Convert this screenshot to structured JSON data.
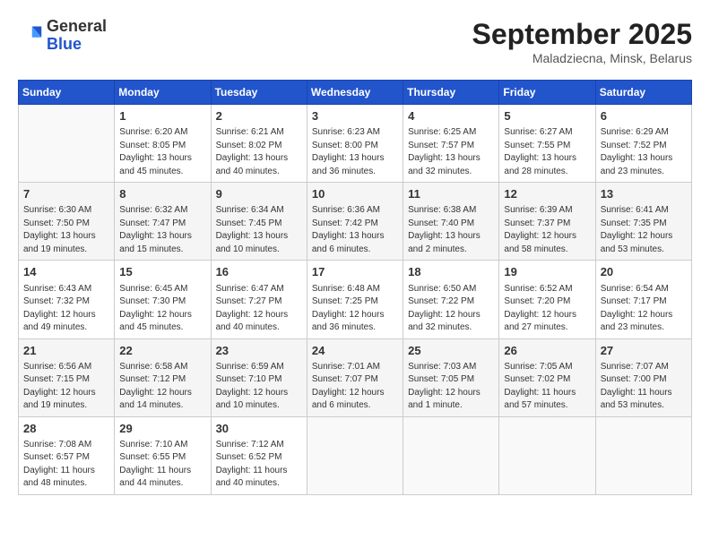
{
  "header": {
    "logo_general": "General",
    "logo_blue": "Blue",
    "month_title": "September 2025",
    "location": "Maladziecna, Minsk, Belarus"
  },
  "weekdays": [
    "Sunday",
    "Monday",
    "Tuesday",
    "Wednesday",
    "Thursday",
    "Friday",
    "Saturday"
  ],
  "weeks": [
    [
      {
        "day": "",
        "content": ""
      },
      {
        "day": "1",
        "content": "Sunrise: 6:20 AM\nSunset: 8:05 PM\nDaylight: 13 hours\nand 45 minutes."
      },
      {
        "day": "2",
        "content": "Sunrise: 6:21 AM\nSunset: 8:02 PM\nDaylight: 13 hours\nand 40 minutes."
      },
      {
        "day": "3",
        "content": "Sunrise: 6:23 AM\nSunset: 8:00 PM\nDaylight: 13 hours\nand 36 minutes."
      },
      {
        "day": "4",
        "content": "Sunrise: 6:25 AM\nSunset: 7:57 PM\nDaylight: 13 hours\nand 32 minutes."
      },
      {
        "day": "5",
        "content": "Sunrise: 6:27 AM\nSunset: 7:55 PM\nDaylight: 13 hours\nand 28 minutes."
      },
      {
        "day": "6",
        "content": "Sunrise: 6:29 AM\nSunset: 7:52 PM\nDaylight: 13 hours\nand 23 minutes."
      }
    ],
    [
      {
        "day": "7",
        "content": "Sunrise: 6:30 AM\nSunset: 7:50 PM\nDaylight: 13 hours\nand 19 minutes."
      },
      {
        "day": "8",
        "content": "Sunrise: 6:32 AM\nSunset: 7:47 PM\nDaylight: 13 hours\nand 15 minutes."
      },
      {
        "day": "9",
        "content": "Sunrise: 6:34 AM\nSunset: 7:45 PM\nDaylight: 13 hours\nand 10 minutes."
      },
      {
        "day": "10",
        "content": "Sunrise: 6:36 AM\nSunset: 7:42 PM\nDaylight: 13 hours\nand 6 minutes."
      },
      {
        "day": "11",
        "content": "Sunrise: 6:38 AM\nSunset: 7:40 PM\nDaylight: 13 hours\nand 2 minutes."
      },
      {
        "day": "12",
        "content": "Sunrise: 6:39 AM\nSunset: 7:37 PM\nDaylight: 12 hours\nand 58 minutes."
      },
      {
        "day": "13",
        "content": "Sunrise: 6:41 AM\nSunset: 7:35 PM\nDaylight: 12 hours\nand 53 minutes."
      }
    ],
    [
      {
        "day": "14",
        "content": "Sunrise: 6:43 AM\nSunset: 7:32 PM\nDaylight: 12 hours\nand 49 minutes."
      },
      {
        "day": "15",
        "content": "Sunrise: 6:45 AM\nSunset: 7:30 PM\nDaylight: 12 hours\nand 45 minutes."
      },
      {
        "day": "16",
        "content": "Sunrise: 6:47 AM\nSunset: 7:27 PM\nDaylight: 12 hours\nand 40 minutes."
      },
      {
        "day": "17",
        "content": "Sunrise: 6:48 AM\nSunset: 7:25 PM\nDaylight: 12 hours\nand 36 minutes."
      },
      {
        "day": "18",
        "content": "Sunrise: 6:50 AM\nSunset: 7:22 PM\nDaylight: 12 hours\nand 32 minutes."
      },
      {
        "day": "19",
        "content": "Sunrise: 6:52 AM\nSunset: 7:20 PM\nDaylight: 12 hours\nand 27 minutes."
      },
      {
        "day": "20",
        "content": "Sunrise: 6:54 AM\nSunset: 7:17 PM\nDaylight: 12 hours\nand 23 minutes."
      }
    ],
    [
      {
        "day": "21",
        "content": "Sunrise: 6:56 AM\nSunset: 7:15 PM\nDaylight: 12 hours\nand 19 minutes."
      },
      {
        "day": "22",
        "content": "Sunrise: 6:58 AM\nSunset: 7:12 PM\nDaylight: 12 hours\nand 14 minutes."
      },
      {
        "day": "23",
        "content": "Sunrise: 6:59 AM\nSunset: 7:10 PM\nDaylight: 12 hours\nand 10 minutes."
      },
      {
        "day": "24",
        "content": "Sunrise: 7:01 AM\nSunset: 7:07 PM\nDaylight: 12 hours\nand 6 minutes."
      },
      {
        "day": "25",
        "content": "Sunrise: 7:03 AM\nSunset: 7:05 PM\nDaylight: 12 hours\nand 1 minute."
      },
      {
        "day": "26",
        "content": "Sunrise: 7:05 AM\nSunset: 7:02 PM\nDaylight: 11 hours\nand 57 minutes."
      },
      {
        "day": "27",
        "content": "Sunrise: 7:07 AM\nSunset: 7:00 PM\nDaylight: 11 hours\nand 53 minutes."
      }
    ],
    [
      {
        "day": "28",
        "content": "Sunrise: 7:08 AM\nSunset: 6:57 PM\nDaylight: 11 hours\nand 48 minutes."
      },
      {
        "day": "29",
        "content": "Sunrise: 7:10 AM\nSunset: 6:55 PM\nDaylight: 11 hours\nand 44 minutes."
      },
      {
        "day": "30",
        "content": "Sunrise: 7:12 AM\nSunset: 6:52 PM\nDaylight: 11 hours\nand 40 minutes."
      },
      {
        "day": "",
        "content": ""
      },
      {
        "day": "",
        "content": ""
      },
      {
        "day": "",
        "content": ""
      },
      {
        "day": "",
        "content": ""
      }
    ]
  ]
}
